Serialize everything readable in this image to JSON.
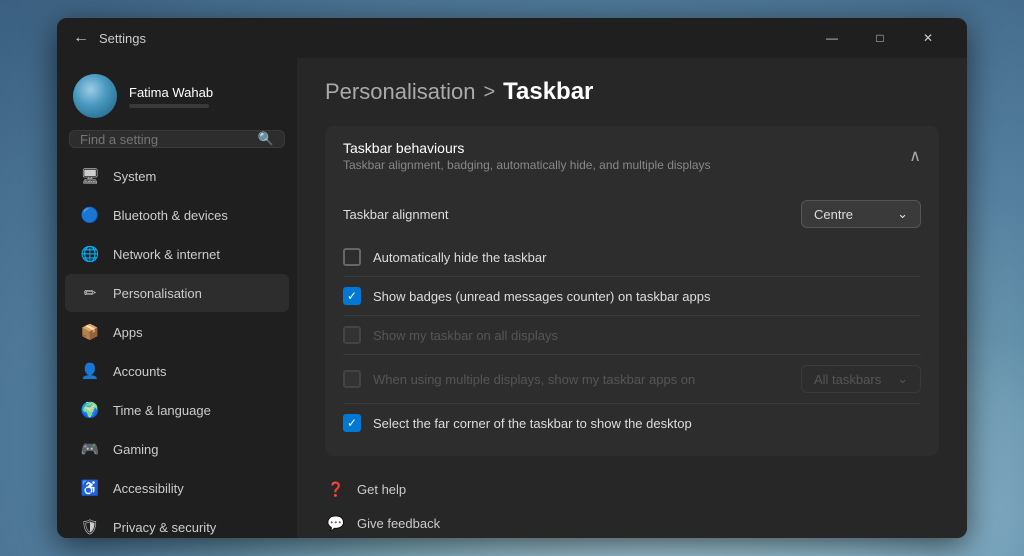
{
  "window": {
    "title": "Settings",
    "minimize": "—",
    "maximize": "□",
    "close": "✕"
  },
  "titlebar": {
    "back_icon": "←",
    "title": "Settings"
  },
  "user": {
    "name": "Fatima Wahab"
  },
  "search": {
    "placeholder": "Find a setting"
  },
  "nav": {
    "items": [
      {
        "id": "system",
        "icon": "🖥",
        "label": "System"
      },
      {
        "id": "bluetooth",
        "icon": "🔵",
        "label": "Bluetooth & devices"
      },
      {
        "id": "network",
        "icon": "🌐",
        "label": "Network & internet"
      },
      {
        "id": "personalisation",
        "icon": "✏",
        "label": "Personalisation",
        "active": true
      },
      {
        "id": "apps",
        "icon": "📦",
        "label": "Apps"
      },
      {
        "id": "accounts",
        "icon": "👤",
        "label": "Accounts"
      },
      {
        "id": "time",
        "icon": "🌍",
        "label": "Time & language"
      },
      {
        "id": "gaming",
        "icon": "🎮",
        "label": "Gaming"
      },
      {
        "id": "accessibility",
        "icon": "♿",
        "label": "Accessibility"
      },
      {
        "id": "privacy",
        "icon": "🛡",
        "label": "Privacy & security"
      }
    ]
  },
  "breadcrumb": {
    "parent": "Personalisation",
    "separator": ">",
    "current": "Taskbar"
  },
  "section": {
    "title": "Taskbar behaviours",
    "subtitle": "Taskbar alignment, badging, automatically hide, and multiple displays",
    "chevron": "∧",
    "settings": [
      {
        "type": "dropdown",
        "label": "Taskbar alignment",
        "value": "Centre",
        "muted": false
      }
    ],
    "checkboxes": [
      {
        "id": "auto-hide",
        "label": "Automatically hide the taskbar",
        "checked": false,
        "disabled": false
      },
      {
        "id": "show-badges",
        "label": "Show badges (unread messages counter) on taskbar apps",
        "checked": true,
        "disabled": false
      },
      {
        "id": "show-all-displays",
        "label": "Show my taskbar on all displays",
        "checked": false,
        "disabled": true
      },
      {
        "id": "show-apps-on",
        "label": "When using multiple displays, show my taskbar apps on",
        "checked": false,
        "disabled": true,
        "dropdown": "All taskbars",
        "has_dropdown": true
      },
      {
        "id": "select-corner",
        "label": "Select the far corner of the taskbar to show the desktop",
        "checked": true,
        "disabled": false
      }
    ]
  },
  "footer": {
    "links": [
      {
        "icon": "❓",
        "label": "Get help"
      },
      {
        "icon": "💬",
        "label": "Give feedback"
      }
    ]
  }
}
